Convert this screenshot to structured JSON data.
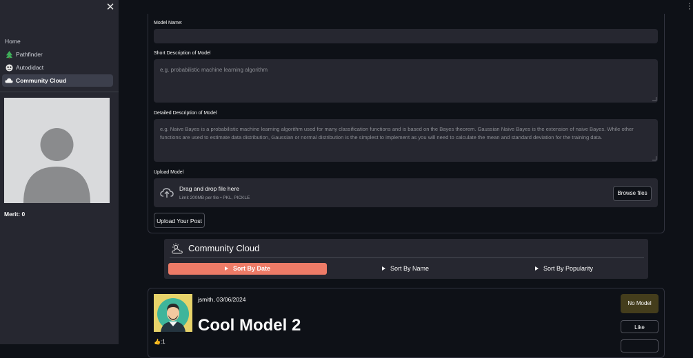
{
  "sidebar": {
    "close_glyph": "✕",
    "items": [
      {
        "label": "Home",
        "icon": "none"
      },
      {
        "label": "Pathfinder",
        "icon": "tree-icon"
      },
      {
        "label": "Autodidact",
        "icon": "mask-icon"
      },
      {
        "label": "Community Cloud",
        "icon": "cloud-icon",
        "active": true
      }
    ],
    "merit_label": "Merit:",
    "merit_value": "0"
  },
  "form": {
    "model_name_label": "Model Name:",
    "model_name_value": "",
    "short_desc_label": "Short Description of Model",
    "short_desc_placeholder": "e.g.  probabilistic machine learning algorithm",
    "detailed_desc_label": "Detailed Description of Model",
    "detailed_desc_placeholder": "e.g. Naive Bayes is a probabilistic machine learning algorithm used for many classification functions and is based on the Bayes theorem. Gaussian Naive Bayes is the extension of naive Bayes. While other functions are used to estimate data distribution, Gaussian or normal distribution is the simplest to implement as you will need to calculate the mean and standard deviation for the training data.",
    "upload_label": "Upload Model",
    "drag_drop": "Drag and drop file here",
    "limit": "Limit 200MB per file • PKL, PICKLE",
    "browse": "Browse files",
    "submit": "Upload Your Post"
  },
  "community": {
    "title": "Community Cloud",
    "sort_buttons": [
      {
        "label": "Sort By Date",
        "active": true
      },
      {
        "label": "Sort By Name",
        "active": false
      },
      {
        "label": "Sort By Popularity",
        "active": false
      }
    ]
  },
  "post": {
    "meta": "jsmith, 03/06/2024",
    "title": "Cool Model 2",
    "likes": "👍:1",
    "no_model": "No Model",
    "like": "Like"
  },
  "colors": {
    "accent": "#ed7b67",
    "background": "#0e1117",
    "sidebar": "#262730",
    "no_model_bg": "#443d1c"
  }
}
